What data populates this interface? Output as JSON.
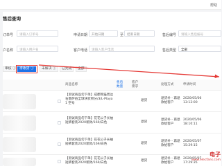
{
  "topbar": {
    "right_text": "帮助"
  },
  "page_title": "售后查询",
  "filters": {
    "row1": [
      {
        "label": "订单号",
        "placeholder": "请输入订单号"
      },
      {
        "label": "申请日期",
        "placeholder": "开始日期"
      },
      {
        "label": "至",
        "placeholder": "结束日期"
      },
      {
        "label": "售后编号",
        "placeholder": "请输入售后编号"
      }
    ],
    "row2": [
      {
        "label": "户名称",
        "placeholder": "请输入用户名"
      },
      {
        "label": "客户电话",
        "placeholder": "请输入客户电话"
      },
      {
        "label": "售后类型",
        "value": "全部"
      }
    ]
  },
  "tabs": [
    {
      "label": "审核 ⓘ"
    },
    {
      "label": "待收货 ⓘ",
      "active": true
    },
    {
      "label": "未解决 ⓘ"
    },
    {
      "label": "已完成"
    },
    {
      "label": "全部"
    }
  ],
  "table": {
    "headers": [
      "商品名称",
      "售后数量",
      "客户需求",
      "处理方式",
      "申请时间"
    ],
    "rows": [
      {
        "product": "【测试商品勿下单】成都熊猫周边 石墨萨伯全球块状积分/3/L-Playa 1 空号",
        "need": "退货",
        "method": "退货补 - 再退款给客户",
        "date": "2020/05/06",
        "time": "13:12:00"
      },
      {
        "product": "【测试商品勿下单】花花公子长袖短裤套装2020新款/169/白色",
        "need": "退货",
        "method": "退货补 - 再退款给客户",
        "date": "2020/05/06",
        "time": "18:10:11"
      },
      {
        "product": "【测试商品勿下单】花花公子长袖短裤套装2020新款/169/白色",
        "need": "退货",
        "method": "退货补 - 再退款给客户",
        "date": "2020/05/07",
        "time": "15:29:15"
      },
      {
        "product": "【测试商品勿下单】花花公子长袖短裤套装2020新款/169/白色",
        "need": "退货",
        "method": "退货补 - 再退款给客户",
        "date": "2020/05/07",
        "time": "17:29:35"
      }
    ]
  },
  "watermark": {
    "big": "电子",
    "small": "www.elecfans.com"
  }
}
